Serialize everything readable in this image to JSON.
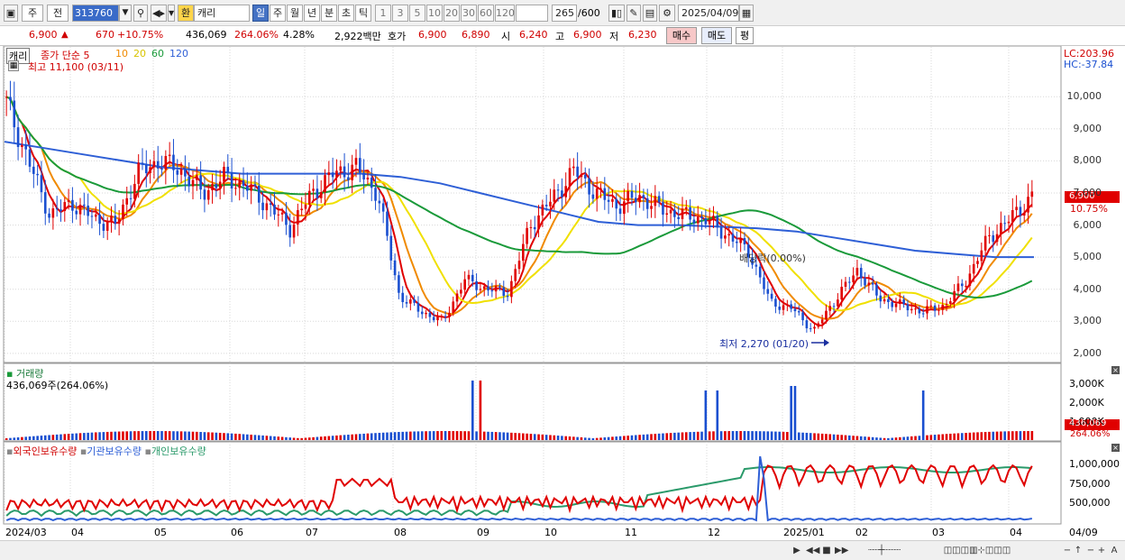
{
  "toolbar": {
    "market": "주",
    "prev": "전",
    "stock_code": "313760",
    "fav_flag": "환",
    "stock_name": "캐리",
    "periods": [
      "일",
      "주",
      "월",
      "년",
      "분",
      "초",
      "틱"
    ],
    "period_selected": "일",
    "intervals": [
      "1",
      "3",
      "5",
      "10",
      "20",
      "30",
      "60",
      "120"
    ],
    "count": "265",
    "total": "/600",
    "date": "2025/04/09"
  },
  "quote": {
    "price": "6,900",
    "change": "670",
    "change_pct": "+10.75%",
    "volume": "436,069",
    "volume_ratio": "264.06%",
    "turnover": "4.28%",
    "amount": "2,922백만",
    "bid_label": "호가",
    "ask": "6,900",
    "bid": "6,890",
    "open_label": "시",
    "open": "6,240",
    "high_label": "고",
    "high": "6,900",
    "low_label": "저",
    "low": "6,230",
    "buy_label": "매수",
    "sell_label": "매도",
    "eval_label": "평"
  },
  "legend": {
    "name": "캐리",
    "ma_title": "종가 단순 5",
    "ma10": "10",
    "ma20": "20",
    "ma60": "60",
    "ma120": "120",
    "high_note": "최고 11,100 (03/11)",
    "low_note": "최저 2,270 (01/20)",
    "dividend_note": "배당락(0.00%)",
    "lc": "LC:203.96",
    "hc": "HC:-37.84",
    "last_price": "6,900",
    "last_pct": "10.75%"
  },
  "volume_panel": {
    "title": "거래량",
    "value": "436,069주(264.06%)",
    "ticks": [
      "3,000K",
      "2,000K",
      "1,000K"
    ],
    "last": "436,069",
    "last_pct": "264.06%"
  },
  "holdings_panel": {
    "labels": [
      "외국인보유수량",
      "기관보유수량",
      "개인보유수량"
    ],
    "ticks": [
      "1,000,000",
      "750,000",
      "500,000"
    ]
  },
  "x_axis": [
    "2024/03",
    "04",
    "05",
    "06",
    "07",
    "08",
    "09",
    "10",
    "11",
    "12",
    "2025/01",
    "02",
    "03",
    "04",
    "04/09"
  ],
  "colors": {
    "up": "#e00000",
    "down": "#1a4fd0",
    "ma5": "#e00000",
    "ma10": "#f08a00",
    "ma20": "#f0e000",
    "ma60": "#1a9a3a",
    "ma120": "#2e5fd6",
    "foreign": "#e00000",
    "institution": "#2e5fd6",
    "individual": "#2a9a6a"
  },
  "chart_data": {
    "type": "line",
    "title": "캐리 (313760)",
    "y_ticks": [
      10000,
      9000,
      8000,
      7000,
      6000,
      5000,
      4000,
      3000,
      2000
    ],
    "ylim": [
      1800,
      11300
    ],
    "x_labels": [
      "2024/03",
      "04",
      "05",
      "06",
      "07",
      "08",
      "09",
      "10",
      "11",
      "12",
      "2025/01",
      "02",
      "03",
      "04"
    ],
    "series": [
      {
        "name": "종가",
        "values": [
          9800,
          8000,
          6300,
          6700,
          6200,
          6000,
          7600,
          8000,
          7700,
          7000,
          7500,
          7200,
          6600,
          5900,
          7000,
          7600,
          7800,
          7000,
          3800,
          3300,
          3000,
          4300,
          4000,
          3900,
          6000,
          6800,
          7700,
          7000,
          6600,
          6900,
          6500,
          6300,
          6200,
          5700,
          5200,
          3600,
          3400,
          2700,
          3700,
          4600,
          3700,
          3500,
          3300,
          3500,
          4300,
          5600,
          6200,
          6900
        ]
      },
      {
        "name": "120",
        "values": [
          8600,
          8400,
          8200,
          8000,
          7800,
          7700,
          7600,
          7600,
          7600,
          7600,
          7500,
          7300,
          7000,
          6700,
          6400,
          6100,
          6000,
          6000,
          5950,
          5900,
          5800,
          5600,
          5400,
          5200,
          5100,
          5000,
          5000
        ]
      }
    ]
  }
}
